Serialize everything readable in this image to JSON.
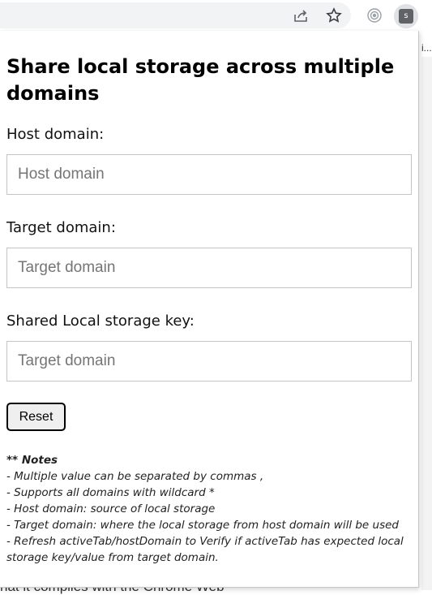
{
  "toolbar": {
    "icons": [
      "share-icon",
      "bookmark-star-icon",
      "extension-circle-icon",
      "extension-s-icon"
    ],
    "extension_letter": "s"
  },
  "background_page": {
    "right_snippet": "i...",
    "bottom_snippet": "hat it complies with the Chrome Web"
  },
  "popup": {
    "title": "Share local storage across multiple domains",
    "fields": [
      {
        "label": "Host domain:",
        "placeholder": "Host domain",
        "value": ""
      },
      {
        "label": "Target domain:",
        "placeholder": "Target domain",
        "value": ""
      },
      {
        "label": "Shared Local storage key:",
        "placeholder": "Target domain",
        "value": ""
      }
    ],
    "reset_label": "Reset",
    "notes": {
      "title": "** Notes",
      "lines": [
        "- Multiple value can be separated by commas ,",
        "- Supports all domains with wildcard *",
        "- Host domain: source of local storage",
        "- Target domain: where the local storage from host domain will be used",
        "- Refresh activeTab/hostDomain to Verify if activeTab has expected local storage key/value from target domain."
      ]
    }
  }
}
